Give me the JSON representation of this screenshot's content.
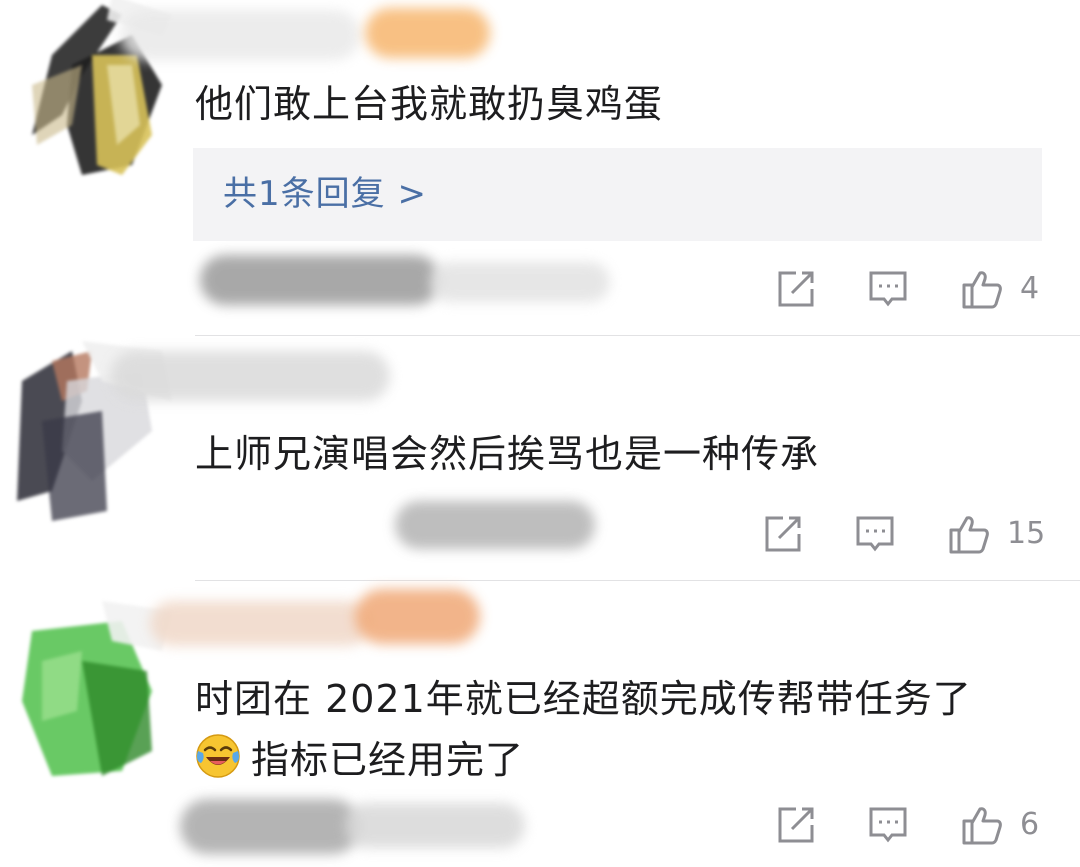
{
  "comments": [
    {
      "text": "他们敢上台我就敢扔臭鸡蛋",
      "reply_link": "共1条回复 >",
      "likes": "4"
    },
    {
      "text": "上师兄演唱会然后挨骂也是一种传承",
      "likes": "15"
    },
    {
      "text_line1": "时团在 2021年就已经超额完成传帮带任务了",
      "text_line2": "指标已经用完了",
      "emoji_name": "laughing-crying-emoji",
      "likes": "6"
    }
  ],
  "icons": {
    "share": "share-icon",
    "comment": "comment-icon",
    "like": "thumbs-up-icon"
  },
  "colors": {
    "reply_link": "#4a6fa5",
    "reply_bg": "#f3f3f5",
    "meta_gray": "#8e8e93"
  }
}
